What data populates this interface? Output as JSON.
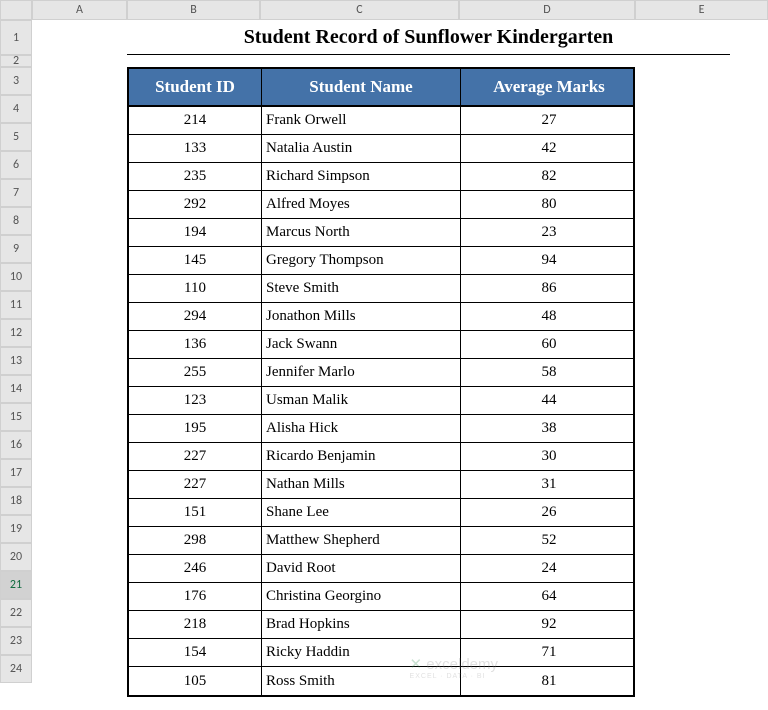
{
  "title": "Student Record of Sunflower Kindergarten",
  "columns": [
    "A",
    "B",
    "C",
    "D",
    "E"
  ],
  "rows": [
    "1",
    "2",
    "3",
    "4",
    "5",
    "6",
    "7",
    "8",
    "9",
    "10",
    "11",
    "12",
    "13",
    "14",
    "15",
    "16",
    "17",
    "18",
    "19",
    "20",
    "21",
    "22",
    "23",
    "24"
  ],
  "selectedRow": "21",
  "headers": {
    "id": "Student ID",
    "name": "Student Name",
    "marks": "Average Marks"
  },
  "students": [
    {
      "id": "214",
      "name": "Frank Orwell",
      "marks": "27"
    },
    {
      "id": "133",
      "name": "Natalia Austin",
      "marks": "42"
    },
    {
      "id": "235",
      "name": "Richard Simpson",
      "marks": "82"
    },
    {
      "id": "292",
      "name": "Alfred Moyes",
      "marks": "80"
    },
    {
      "id": "194",
      "name": "Marcus North",
      "marks": "23"
    },
    {
      "id": "145",
      "name": "Gregory Thompson",
      "marks": "94"
    },
    {
      "id": "110",
      "name": "Steve Smith",
      "marks": "86"
    },
    {
      "id": "294",
      "name": "Jonathon Mills",
      "marks": "48"
    },
    {
      "id": "136",
      "name": "Jack Swann",
      "marks": "60"
    },
    {
      "id": "255",
      "name": "Jennifer Marlo",
      "marks": "58"
    },
    {
      "id": "123",
      "name": "Usman Malik",
      "marks": "44"
    },
    {
      "id": "195",
      "name": "Alisha Hick",
      "marks": "38"
    },
    {
      "id": "227",
      "name": "Ricardo Benjamin",
      "marks": "30"
    },
    {
      "id": "227",
      "name": "Nathan Mills",
      "marks": "31"
    },
    {
      "id": "151",
      "name": "Shane Lee",
      "marks": "26"
    },
    {
      "id": "298",
      "name": "Matthew Shepherd",
      "marks": "52"
    },
    {
      "id": "246",
      "name": "David Root",
      "marks": "24"
    },
    {
      "id": "176",
      "name": "Christina Georgino",
      "marks": "64"
    },
    {
      "id": "218",
      "name": "Brad Hopkins",
      "marks": "92"
    },
    {
      "id": "154",
      "name": "Ricky Haddin",
      "marks": "71"
    },
    {
      "id": "105",
      "name": "Ross Smith",
      "marks": "81"
    }
  ],
  "watermark": {
    "main": "exceldemy",
    "sub": "EXCEL · DATA · BI"
  }
}
